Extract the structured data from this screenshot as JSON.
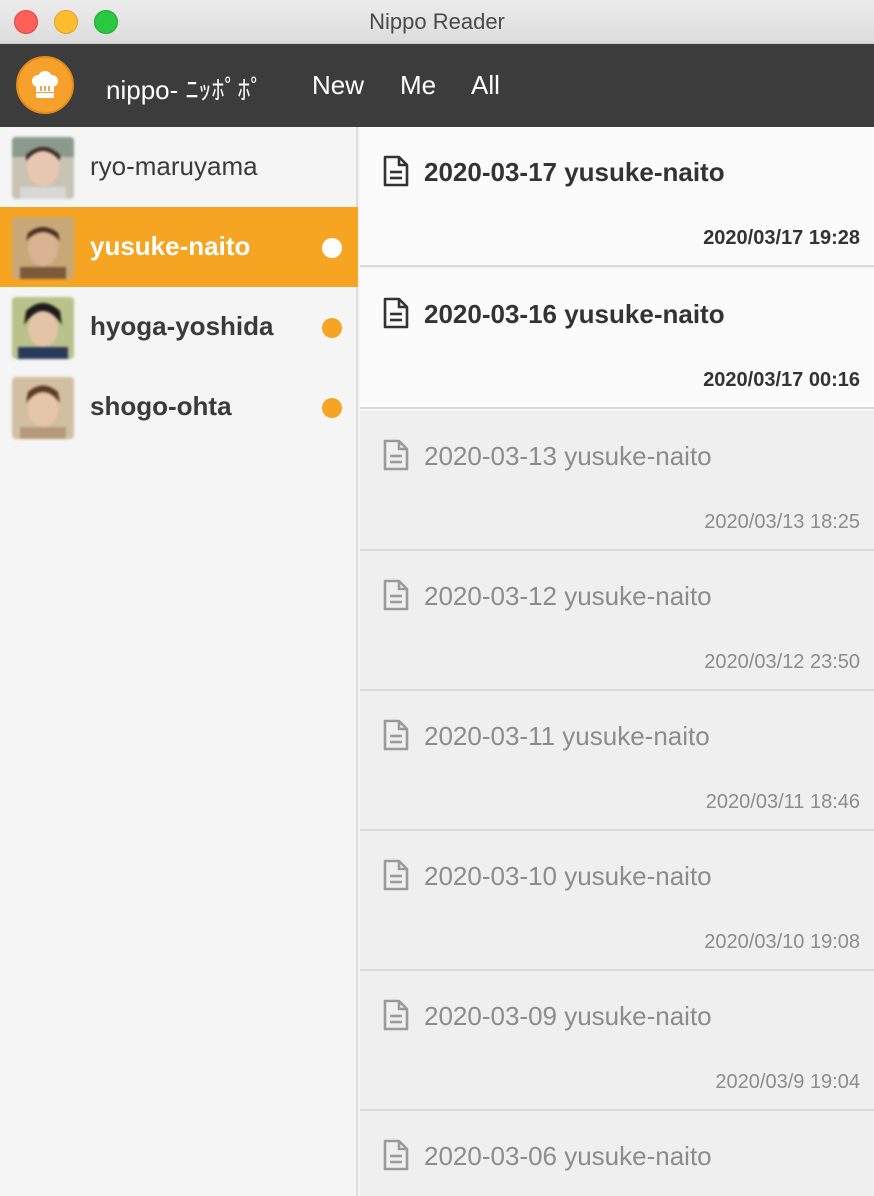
{
  "window": {
    "title": "Nippo Reader"
  },
  "toolbar": {
    "brand": "nippo- ﾆｯﾎﾟﾎﾟ",
    "nav": [
      {
        "label": "New"
      },
      {
        "label": "Me"
      },
      {
        "label": "All"
      }
    ]
  },
  "colors": {
    "accent": "#f6a523",
    "toolbar_bg": "#3c3c3c"
  },
  "sidebar": {
    "users": [
      {
        "name": "ryo-maruyama",
        "selected": false,
        "unread": false
      },
      {
        "name": "yusuke-naito",
        "selected": true,
        "unread": true
      },
      {
        "name": "hyoga-yoshida",
        "selected": false,
        "unread": true
      },
      {
        "name": "shogo-ohta",
        "selected": false,
        "unread": true
      }
    ]
  },
  "reports": [
    {
      "title": "2020-03-17 yusuke-naito",
      "date": "2020/03/17 19:28",
      "unread": true
    },
    {
      "title": "2020-03-16 yusuke-naito",
      "date": "2020/03/17 00:16",
      "unread": true
    },
    {
      "title": "2020-03-13 yusuke-naito",
      "date": "2020/03/13 18:25",
      "unread": false
    },
    {
      "title": "2020-03-12 yusuke-naito",
      "date": "2020/03/12 23:50",
      "unread": false
    },
    {
      "title": "2020-03-11 yusuke-naito",
      "date": "2020/03/11 18:46",
      "unread": false
    },
    {
      "title": "2020-03-10 yusuke-naito",
      "date": "2020/03/10 19:08",
      "unread": false
    },
    {
      "title": "2020-03-09 yusuke-naito",
      "date": "2020/03/9 19:04",
      "unread": false
    },
    {
      "title": "2020-03-06 yusuke-naito",
      "date": "",
      "unread": false
    }
  ]
}
